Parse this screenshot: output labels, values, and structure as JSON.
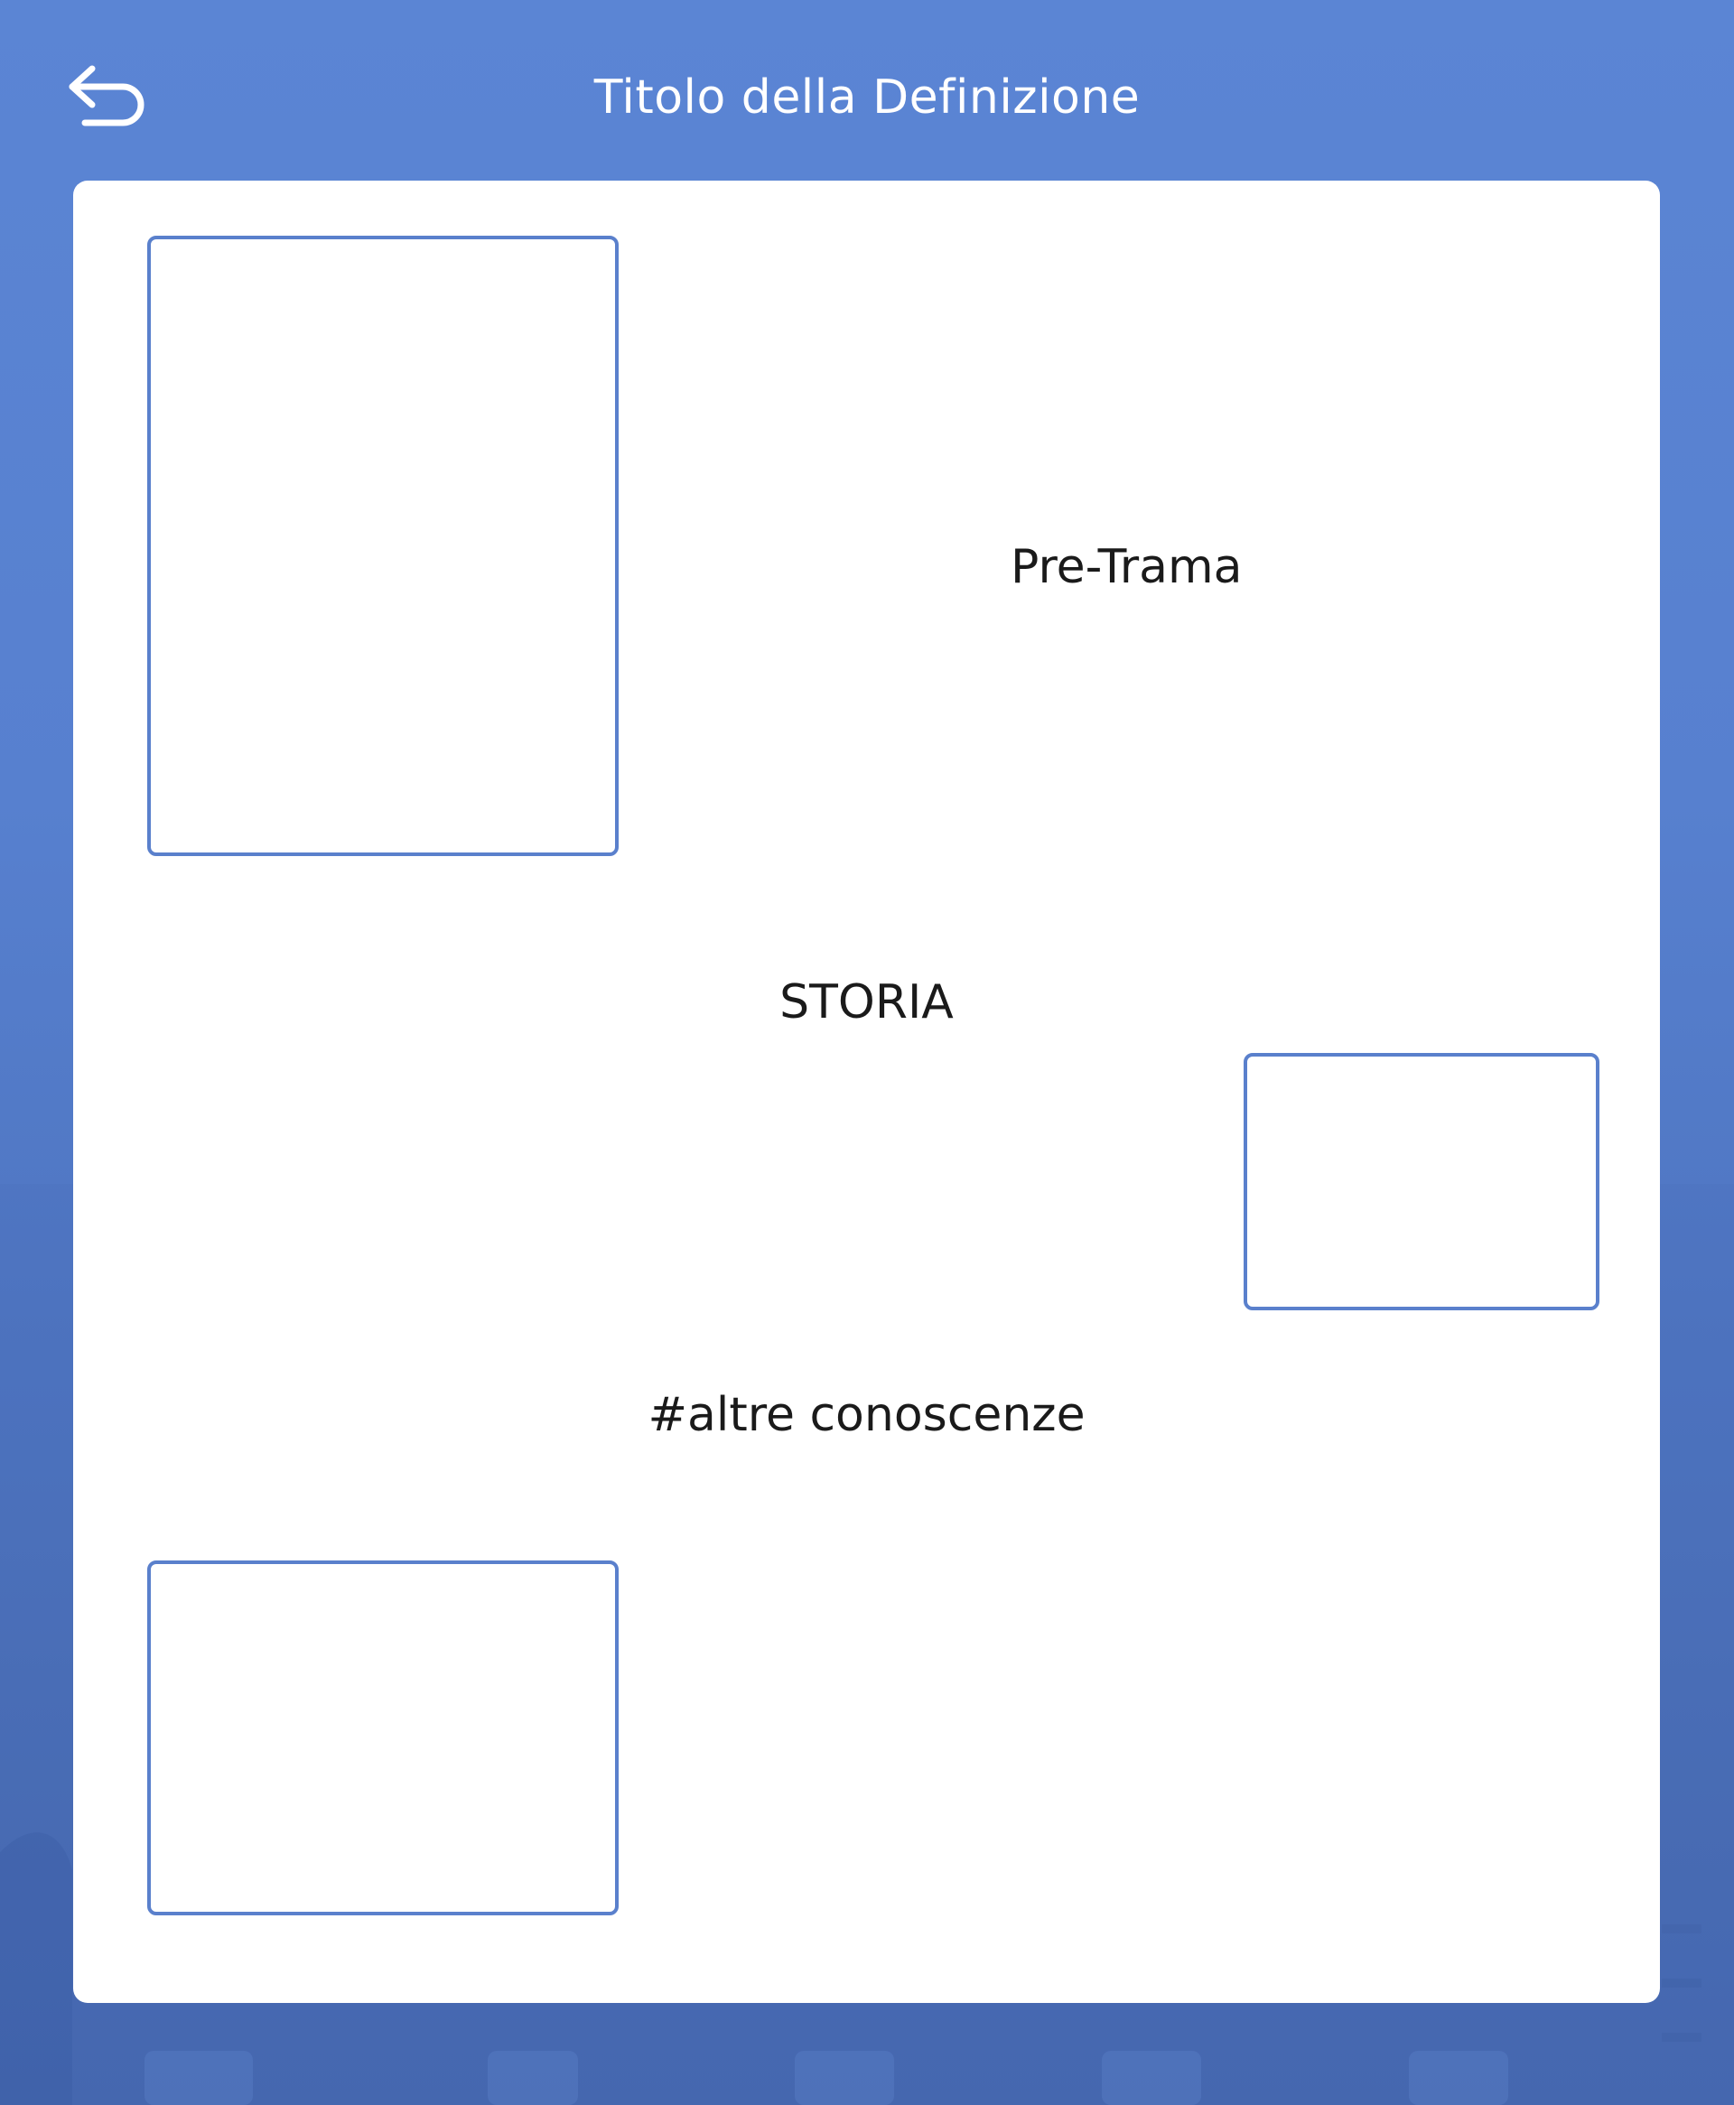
{
  "header": {
    "back_icon": "back-arrow-icon",
    "title": "Titolo della Definizione"
  },
  "content": {
    "sections": [
      {
        "label": "Pre-Trama"
      },
      {
        "label": "STORIA"
      },
      {
        "label": "#altre conoscenze"
      }
    ],
    "image_placeholders": [
      "image-placeholder",
      "image-placeholder",
      "image-placeholder"
    ]
  },
  "colors": {
    "background": "#5b85d4",
    "card": "#ffffff",
    "placeholder_border": "#5a80cc",
    "title_text": "#ffffff",
    "body_text": "#1a1a1a"
  }
}
